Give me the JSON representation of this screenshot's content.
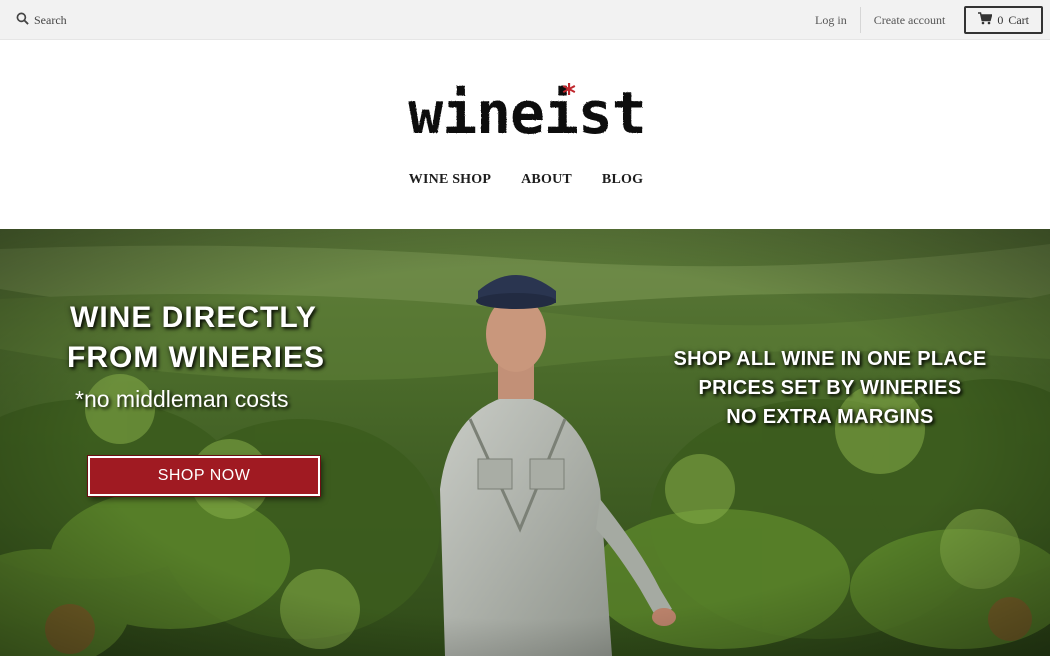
{
  "topbar": {
    "search_label": "Search",
    "search_icon": "search-icon",
    "login_label": "Log in",
    "create_account_label": "Create account",
    "cart_count": "0",
    "cart_label": "Cart",
    "cart_icon": "cart-icon"
  },
  "brand": {
    "logo_text": "wineist",
    "logo_accent_color": "#c0272d"
  },
  "nav": {
    "items": [
      {
        "label": "WINE SHOP"
      },
      {
        "label": "ABOUT"
      },
      {
        "label": "BLOG"
      }
    ]
  },
  "hero": {
    "headline_line1": "WINE DIRECTLY",
    "headline_line2": "FROM WINERIES",
    "tagline": "*no middleman costs",
    "cta_label": "SHOP NOW",
    "cta_color": "#a01a22",
    "benefits": [
      "SHOP ALL WINE IN ONE PLACE",
      "PRICES SET BY WINERIES",
      "NO EXTRA MARGINS"
    ]
  }
}
